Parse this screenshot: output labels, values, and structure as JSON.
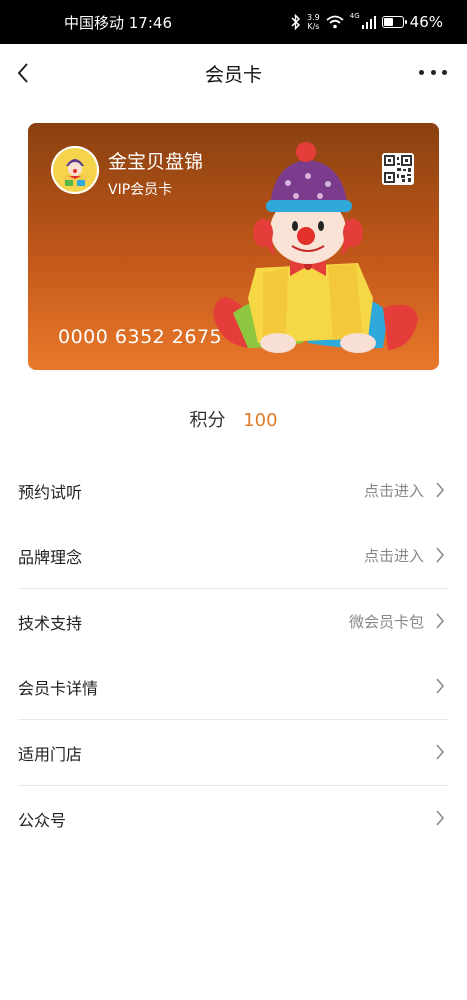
{
  "status_bar": {
    "carrier_time": "中国移动 17:46",
    "speed_value": "3.9",
    "speed_unit": "K/s",
    "network": "4G",
    "battery_text": "46%",
    "battery_level": 0.46,
    "icons": [
      "bluetooth-icon",
      "wifi-icon",
      "signal-icon",
      "battery-icon"
    ]
  },
  "nav": {
    "title": "会员卡",
    "back_icon": "chevron-left-icon",
    "more_icon": "more-horizontal-icon"
  },
  "card": {
    "brand_name": "金宝贝盘锦",
    "level": "VIP会员卡",
    "card_number": "0000 6352 2675",
    "qr_icon": "qr-code-icon",
    "illustration": "clown"
  },
  "points": {
    "label": "积分",
    "value": "100",
    "value_color": "#e07b2a"
  },
  "menu": [
    {
      "label": "预约试听",
      "hint": "点击进入"
    },
    {
      "label": "品牌理念",
      "hint": "点击进入"
    },
    {
      "label": "技术支持",
      "hint": "微会员卡包"
    },
    {
      "label": "会员卡详情",
      "hint": ""
    },
    {
      "label": "适用门店",
      "hint": ""
    },
    {
      "label": "公众号",
      "hint": ""
    }
  ]
}
